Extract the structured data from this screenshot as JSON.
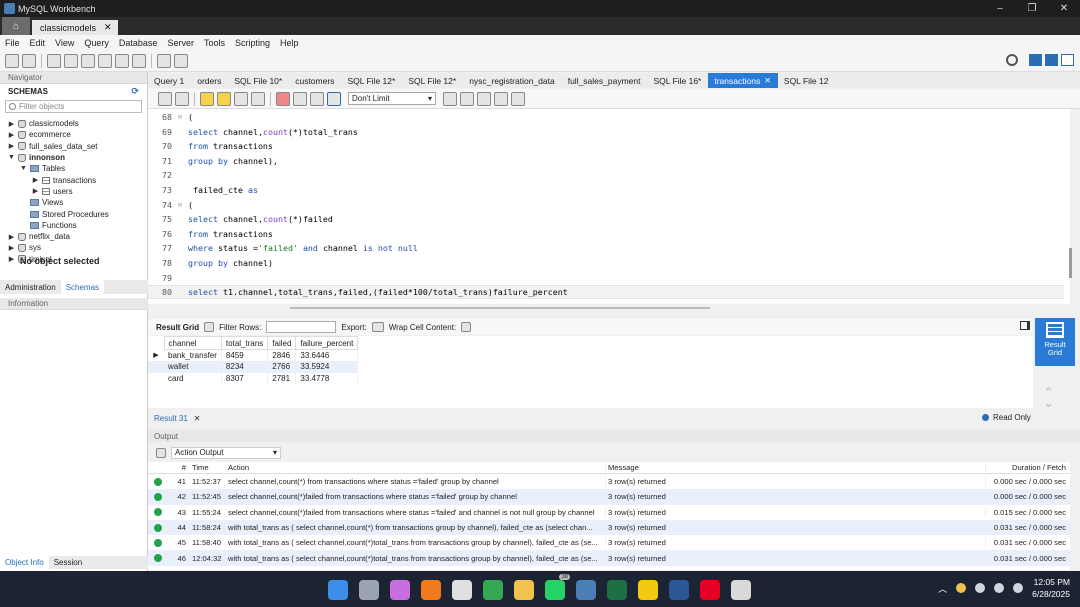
{
  "window": {
    "title": "MySQL Workbench",
    "connection_tab": "classicmodels"
  },
  "menu": [
    "File",
    "Edit",
    "View",
    "Query",
    "Database",
    "Server",
    "Tools",
    "Scripting",
    "Help"
  ],
  "navigator": {
    "header": "Navigator",
    "schemas_title": "SCHEMAS",
    "filter_placeholder": "Filter objects",
    "tree": [
      {
        "label": "classicmodels",
        "level": 0,
        "arrow": "▶",
        "icon": "db"
      },
      {
        "label": "ecommerce",
        "level": 0,
        "arrow": "▶",
        "icon": "db"
      },
      {
        "label": "full_sales_data_set",
        "level": 0,
        "arrow": "▶",
        "icon": "db"
      },
      {
        "label": "innonson",
        "level": 0,
        "arrow": "▼",
        "icon": "db",
        "bold": true
      },
      {
        "label": "Tables",
        "level": 1,
        "arrow": "▼",
        "icon": "folder"
      },
      {
        "label": "transactions",
        "level": 2,
        "arrow": "▶",
        "icon": "table"
      },
      {
        "label": "users",
        "level": 2,
        "arrow": "▶",
        "icon": "table"
      },
      {
        "label": "Views",
        "level": 1,
        "arrow": "",
        "icon": "folder"
      },
      {
        "label": "Stored Procedures",
        "level": 1,
        "arrow": "",
        "icon": "folder"
      },
      {
        "label": "Functions",
        "level": 1,
        "arrow": "",
        "icon": "folder"
      },
      {
        "label": "netflix_data",
        "level": 0,
        "arrow": "▶",
        "icon": "db"
      },
      {
        "label": "sys",
        "level": 0,
        "arrow": "▶",
        "icon": "db"
      },
      {
        "label": "timisql",
        "level": 0,
        "arrow": "▶",
        "icon": "db"
      }
    ],
    "tabs": [
      "Administration",
      "Schemas"
    ],
    "info_header": "Information",
    "no_object": "No object selected",
    "info_tabs": [
      "Object Info",
      "Session"
    ]
  },
  "query_tabs": [
    {
      "label": "Query 1"
    },
    {
      "label": "orders"
    },
    {
      "label": "SQL File 10*"
    },
    {
      "label": "customers"
    },
    {
      "label": "SQL File 12*"
    },
    {
      "label": "SQL File 12*"
    },
    {
      "label": "nysc_registration_data"
    },
    {
      "label": "full_sales_payment"
    },
    {
      "label": "SQL File 16*"
    },
    {
      "label": "transactions",
      "active": true
    },
    {
      "label": "SQL File 12"
    }
  ],
  "editor_toolbar": {
    "limit": "Don't Limit"
  },
  "editor_lines": [
    {
      "n": "68",
      "fold": "⊖",
      "code": "("
    },
    {
      "n": "69",
      "fold": "",
      "code": "select channel,count(*)total_trans"
    },
    {
      "n": "70",
      "fold": "",
      "code": "from transactions"
    },
    {
      "n": "71",
      "fold": "",
      "code": "group by channel),"
    },
    {
      "n": "72",
      "fold": "",
      "code": ""
    },
    {
      "n": "73",
      "fold": "",
      "code": " failed_cte as"
    },
    {
      "n": "74",
      "fold": "⊖",
      "code": "("
    },
    {
      "n": "75",
      "fold": "",
      "code": "select channel,count(*)failed"
    },
    {
      "n": "76",
      "fold": "",
      "code": "from transactions"
    },
    {
      "n": "77",
      "fold": "",
      "code": "where status ='failed' and channel is not null"
    },
    {
      "n": "78",
      "fold": "",
      "code": "group by channel)"
    },
    {
      "n": "79",
      "fold": "",
      "code": ""
    },
    {
      "n": "80",
      "fold": "",
      "code": "select t1.channel,total_trans,failed,(failed*100/total_trans)failure_percent",
      "current": true
    }
  ],
  "result_toolbar": {
    "result_grid": "Result Grid",
    "filter_rows": "Filter Rows:",
    "export": "Export:",
    "wrap": "Wrap Cell Content:"
  },
  "result_grid": {
    "columns": [
      "channel",
      "total_trans",
      "failed",
      "failure_percent"
    ],
    "rows": [
      [
        "bank_transfer",
        "8459",
        "2846",
        "33.6446"
      ],
      [
        "wallet",
        "8234",
        "2766",
        "33.5924"
      ],
      [
        "card",
        "8307",
        "2781",
        "33.4778"
      ]
    ]
  },
  "result_side_button": "Result Grid",
  "result_tab": "Result 31",
  "read_only": "Read Only",
  "output": {
    "header": "Output",
    "selector": "Action Output",
    "columns": {
      "num": "#",
      "time": "Time",
      "action": "Action",
      "message": "Message",
      "duration": "Duration / Fetch"
    },
    "rows": [
      {
        "num": "41",
        "time": "11:52:37",
        "action": "select channel,count(*) from transactions where status ='failed' group by channel",
        "message": "3 row(s) returned",
        "duration": "0.000 sec / 0.000 sec"
      },
      {
        "num": "42",
        "time": "11:52:45",
        "action": "select channel,count(*)failed from transactions where status ='failed' group by channel",
        "message": "3 row(s) returned",
        "duration": "0.000 sec / 0.000 sec"
      },
      {
        "num": "43",
        "time": "11:55:24",
        "action": "select channel,count(*)failed from transactions where status ='failed' and channel is not null group by channel",
        "message": "3 row(s) returned",
        "duration": "0.015 sec / 0.000 sec"
      },
      {
        "num": "44",
        "time": "11:58:24",
        "action": "with total_trans as  ( select channel,count(*) from transactions group by channel),   failed_cte as  (select chan...",
        "message": "3 row(s) returned",
        "duration": "0.031 sec / 0.000 sec"
      },
      {
        "num": "45",
        "time": "11:58:40",
        "action": "with total_trans as  ( select channel,count(*)total_trans from transactions group by channel),   failed_cte as  (se...",
        "message": "3 row(s) returned",
        "duration": "0.031 sec / 0.000 sec"
      },
      {
        "num": "46",
        "time": "12:04:32",
        "action": "with total_trans as  ( select channel,count(*)total_trans from transactions group by channel),   failed_cte as  (se...",
        "message": "3 row(s) returned",
        "duration": "0.031 sec / 0.000 sec"
      }
    ]
  },
  "taskbar": {
    "time": "12:05 PM",
    "date": "6/28/2025",
    "whatsapp_badge": "38",
    "apps": [
      {
        "name": "windows-start-icon",
        "color": "#3b8fe8"
      },
      {
        "name": "file-manager-icon",
        "color": "#9aa4b3"
      },
      {
        "name": "copilot-icon",
        "color": "#c86ee0"
      },
      {
        "name": "firefox-icon",
        "color": "#f07a1c"
      },
      {
        "name": "media-icon",
        "color": "#e0e0e0"
      },
      {
        "name": "chrome-icon",
        "color": "#34a853"
      },
      {
        "name": "folder-icon",
        "color": "#f2c14e"
      },
      {
        "name": "whatsapp-icon",
        "color": "#25d366"
      },
      {
        "name": "mysql-workbench-icon",
        "color": "#4a7fb5"
      },
      {
        "name": "excel-icon",
        "color": "#1d7044"
      },
      {
        "name": "powerbi-icon",
        "color": "#f2c811"
      },
      {
        "name": "word-icon",
        "color": "#2b5797"
      },
      {
        "name": "pinterest-icon",
        "color": "#e60023"
      },
      {
        "name": "chatgpt-icon",
        "color": "#d9d9d9"
      }
    ]
  }
}
